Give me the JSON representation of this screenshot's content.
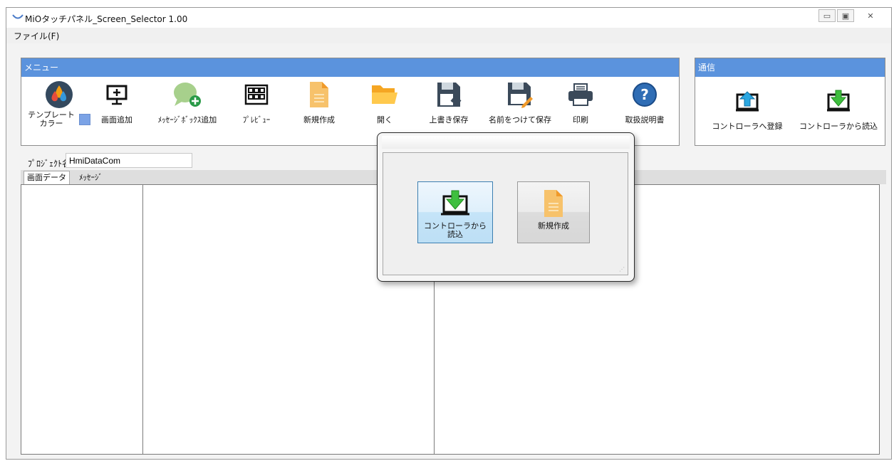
{
  "window": {
    "title": "MiOタッチパネル_Screen_Selector 1.00"
  },
  "menubar": {
    "file": "ファイル(F)"
  },
  "menu_group": {
    "header": "メニュー",
    "template_color_label": "テンプレート\nカラー",
    "template_color_swatch": "#7ba3e6",
    "tools": [
      {
        "label": "画面追加",
        "icon": "add-screen-icon"
      },
      {
        "label": "ﾒｯｾｰｼﾞﾎﾞｯｸｽ追加",
        "icon": "add-message-box-icon"
      },
      {
        "label": "ﾌﾟﾚﾋﾞｭｰ",
        "icon": "preview-icon"
      },
      {
        "label": "新規作成",
        "icon": "new-file-icon"
      },
      {
        "label": "開く",
        "icon": "open-folder-icon"
      },
      {
        "label": "上書き保存",
        "icon": "overwrite-save-icon"
      },
      {
        "label": "名前をつけて保存",
        "icon": "save-as-icon"
      },
      {
        "label": "印刷",
        "icon": "print-icon"
      },
      {
        "label": "取扱説明書",
        "icon": "help-icon"
      }
    ]
  },
  "comm_group": {
    "header": "通信",
    "tools": [
      {
        "label": "コントローラへ登録",
        "icon": "upload-to-controller-icon"
      },
      {
        "label": "コントローラから読込",
        "icon": "download-from-controller-icon"
      }
    ]
  },
  "project": {
    "label": "ﾌﾟﾛｼﾞｪｸﾄ名",
    "value": "HmiDataCom"
  },
  "tabs": [
    {
      "label": "画面データ"
    },
    {
      "label": "ﾒｯｾｰｼﾞ"
    }
  ],
  "dialog": {
    "buttons": [
      {
        "label": "コントローラから\n読込",
        "icon": "download-from-controller-icon"
      },
      {
        "label": "新規作成",
        "icon": "new-file-icon"
      }
    ]
  },
  "colors": {
    "accent": "#5b93dd",
    "green": "#3fbf3f",
    "orange": "#f7c26b",
    "dark": "#3b4a5a"
  }
}
